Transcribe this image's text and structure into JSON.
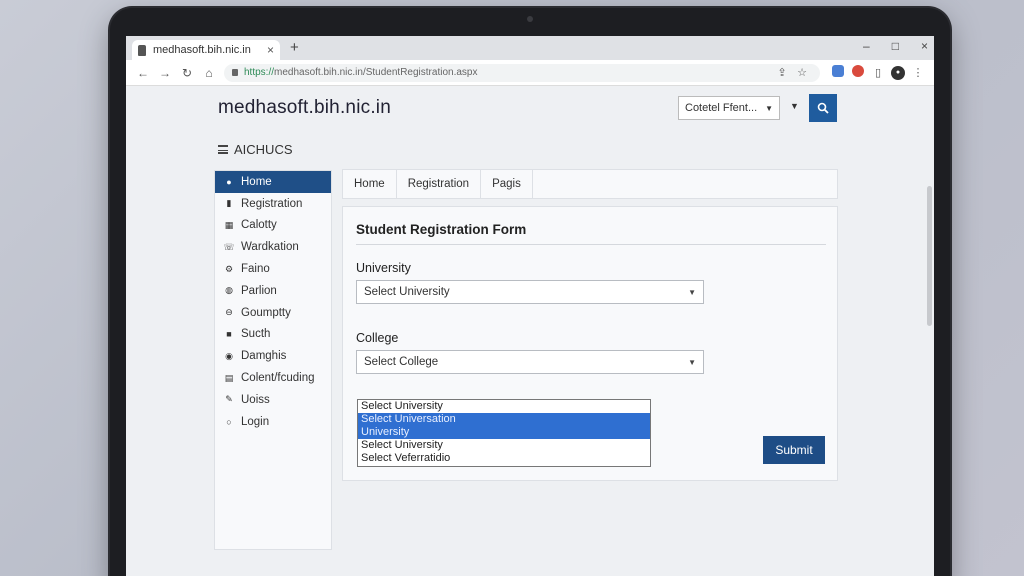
{
  "browser": {
    "tab_title": "medhasoft.bih.nic.in",
    "tab_close": "×",
    "new_tab": "+",
    "window_controls": [
      "–",
      "□",
      "×"
    ],
    "address_protocol": "https://",
    "address_rest": "medhasoft.bih.nic.in/StudentRegistration.aspx"
  },
  "site": {
    "title": "medhasoft.bih.nic.in",
    "select_value": "Cotetel Ffent...",
    "menu_label": "AICHUCS"
  },
  "sidebar": {
    "items": [
      {
        "label": "Home",
        "icon": "person-icon",
        "glyph": "●"
      },
      {
        "label": "Registration",
        "icon": "user-icon",
        "glyph": "▮"
      },
      {
        "label": "Calotty",
        "icon": "calendar-icon",
        "glyph": "▦"
      },
      {
        "label": "Wardkation",
        "icon": "phone-icon",
        "glyph": "☏"
      },
      {
        "label": "Faino",
        "icon": "gear-icon",
        "glyph": "⚙"
      },
      {
        "label": "Parlion",
        "icon": "globe-icon",
        "glyph": "◍"
      },
      {
        "label": "Goumptty",
        "icon": "link-icon",
        "glyph": "⊖"
      },
      {
        "label": "Sucth",
        "icon": "folder-icon",
        "glyph": "■"
      },
      {
        "label": "Damghis",
        "icon": "target-icon",
        "glyph": "◉"
      },
      {
        "label": "Colent/fcuding",
        "icon": "document-icon",
        "glyph": "▤"
      },
      {
        "label": "Uoiss",
        "icon": "pencil-icon",
        "glyph": "✎"
      },
      {
        "label": "Login",
        "icon": "login-icon",
        "glyph": "○"
      }
    ]
  },
  "main": {
    "tabs": [
      "Home",
      "Registration",
      "Pagis"
    ],
    "form_title": "Student Registration Form",
    "university_label": "University",
    "university_value": "Select University",
    "college_label": "College",
    "college_value": "Select College",
    "dropdown_options": [
      "Select University",
      "Select Universation",
      "University",
      "Select University",
      "Select Veferratidio"
    ],
    "submit_label": "Submit"
  },
  "colors": {
    "accent": "#1f4f87",
    "dropdown_highlight": "#2f6fd1"
  }
}
